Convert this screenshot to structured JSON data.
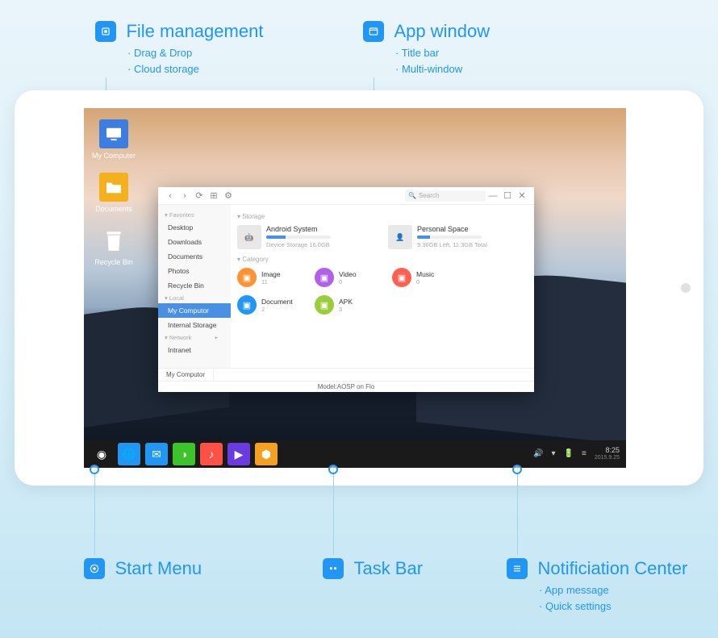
{
  "callouts": {
    "file_mgmt": {
      "title": "File management",
      "bullets": [
        "Drag & Drop",
        "Cloud storage"
      ]
    },
    "app_window": {
      "title": "App window",
      "bullets": [
        "Title bar",
        "Multi-window"
      ]
    },
    "start_menu": {
      "title": "Start Menu"
    },
    "task_bar": {
      "title": "Task Bar"
    },
    "notif_center": {
      "title": "Notificiation Center",
      "bullets": [
        "App message",
        "Quick settings"
      ]
    }
  },
  "desktop": {
    "icons": [
      {
        "name": "My Computer",
        "kind": "computer-icon",
        "bg": "#3b7de0"
      },
      {
        "name": "Documents",
        "kind": "folder-icon",
        "bg": "#f5b020"
      },
      {
        "name": "Recycle Bin",
        "kind": "trash-icon",
        "bg": "transparent"
      }
    ]
  },
  "file_manager": {
    "toolbar": {
      "search_placeholder": "Search"
    },
    "sidebar": {
      "favorites_label": "Favorites",
      "favorites": [
        "Desktop",
        "Downloads",
        "Documents",
        "Photos",
        "Recycle Bin"
      ],
      "local_label": "Local",
      "local": [
        "My Computor",
        "Internal Storage"
      ],
      "local_selected": "My Computor",
      "network_label": "Network",
      "network": [
        "Intranet"
      ]
    },
    "content": {
      "storage_label": "Storage",
      "storage": [
        {
          "name": "Android System",
          "sub": "Device Storage 16.0GB",
          "pct": 30
        },
        {
          "name": "Personal Space",
          "sub": "9.36GB Left, 11.3GB Total",
          "pct": 20
        }
      ],
      "category_label": "Category",
      "categories": [
        {
          "name": "Image",
          "count": "11",
          "color": "#ff9233",
          "icon": "image-icon"
        },
        {
          "name": "Video",
          "count": "0",
          "color": "#b160e8",
          "icon": "video-icon"
        },
        {
          "name": "Music",
          "count": "0",
          "color": "#ff6150",
          "icon": "music-icon"
        },
        {
          "name": "Document",
          "count": "2",
          "color": "#2196f3",
          "icon": "document-icon"
        },
        {
          "name": "APK",
          "count": "3",
          "color": "#9ccc3c",
          "icon": "apk-icon"
        }
      ]
    },
    "footer_tab": "My Computor",
    "model": "Model:AOSP on Flo"
  },
  "taskbar": {
    "apps": [
      {
        "name": "start-menu",
        "color": "#fff",
        "glyph": "◉"
      },
      {
        "name": "browser",
        "color": "#2196f3",
        "glyph": "🌐"
      },
      {
        "name": "mail",
        "color": "#2196f3",
        "glyph": "✉"
      },
      {
        "name": "wechat",
        "color": "#3cc42a",
        "glyph": "◑"
      },
      {
        "name": "music",
        "color": "#ff5145",
        "glyph": "♪"
      },
      {
        "name": "video",
        "color": "#6a3be0",
        "glyph": "▶"
      },
      {
        "name": "store",
        "color": "#f5a020",
        "glyph": "⬢"
      }
    ],
    "tray": {
      "time": "8:25",
      "date": "2015.9.25"
    }
  }
}
